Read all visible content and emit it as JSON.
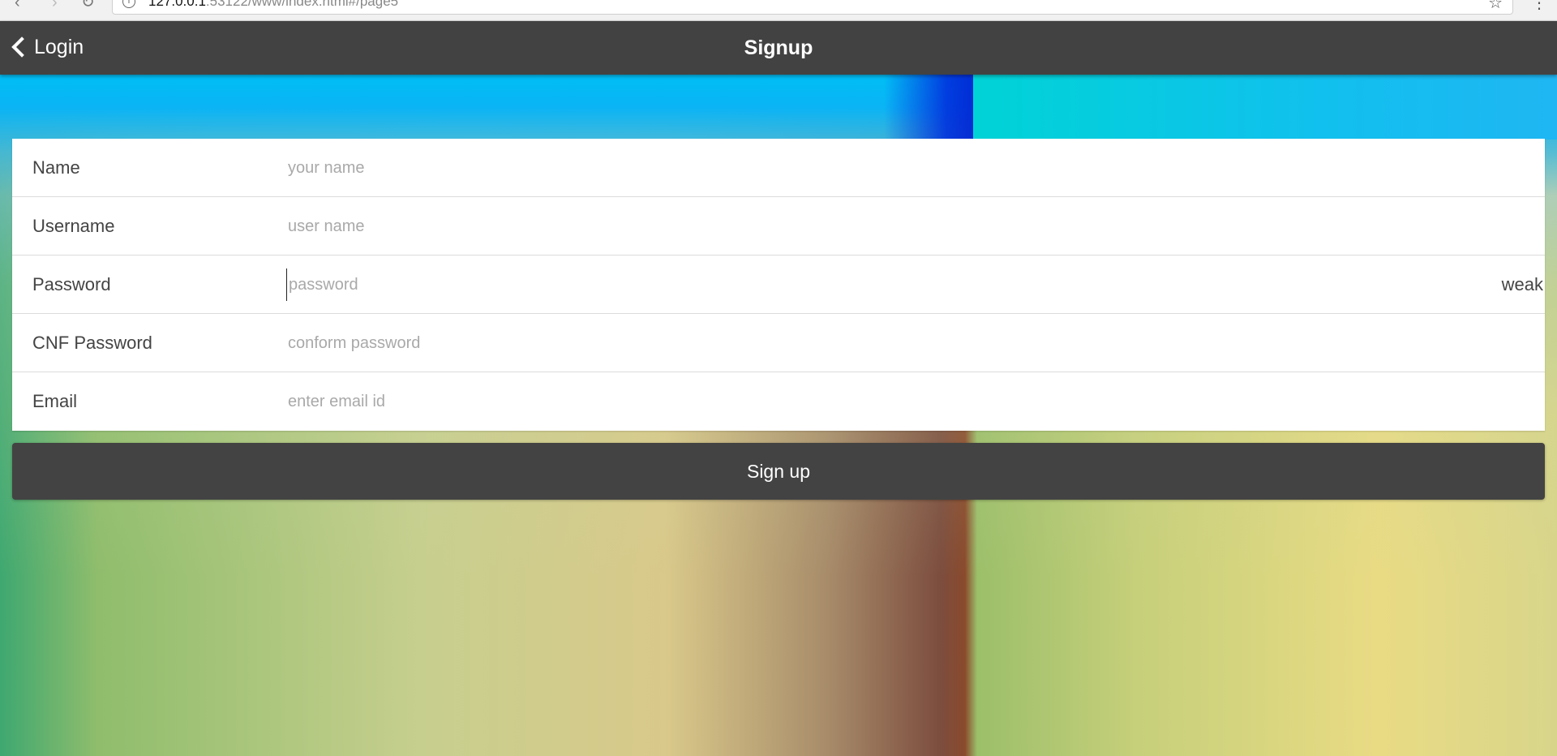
{
  "browser": {
    "url_host": "127.0.0.1",
    "url_rest": ":53122/www/index.html#/page5",
    "back_icon": "chevron-left-icon",
    "forward_icon": "chevron-right-icon",
    "reload_icon": "reload-icon",
    "bookmark_icon": "star-icon",
    "menu_icon": "kebab-menu-icon"
  },
  "header": {
    "back_label": "Login",
    "title": "Signup",
    "background": "#424242"
  },
  "form": {
    "fields": [
      {
        "label": "Name",
        "placeholder": "your name",
        "value": ""
      },
      {
        "label": "Username",
        "placeholder": "user name",
        "value": ""
      },
      {
        "label": "Password",
        "placeholder": "password",
        "value": "",
        "strength": "weak"
      },
      {
        "label": "CNF Password",
        "placeholder": "conform password",
        "value": ""
      },
      {
        "label": "Email",
        "placeholder": "enter email id",
        "value": ""
      }
    ]
  },
  "actions": {
    "signup_label": "Sign up",
    "button_color": "#434343"
  }
}
